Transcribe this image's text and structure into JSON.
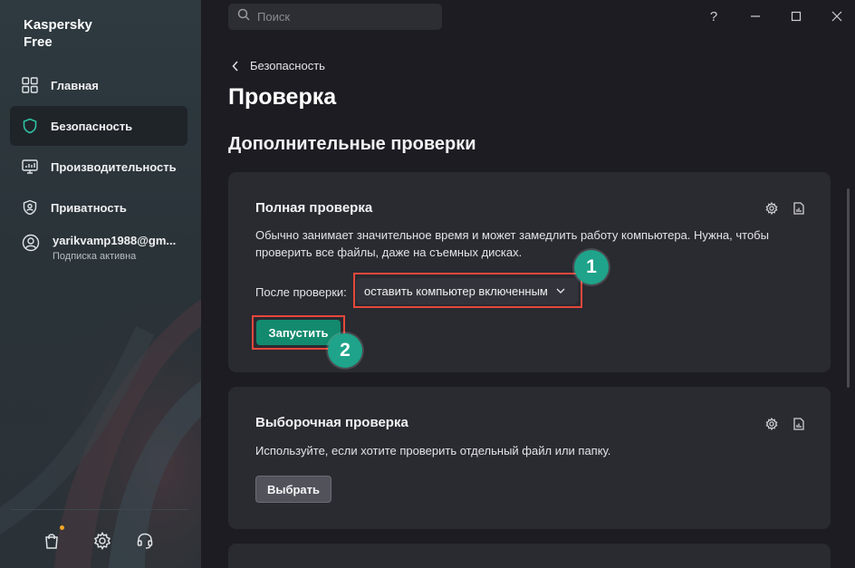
{
  "app": {
    "brand": "Kaspersky\nFree"
  },
  "sidebar": {
    "items": [
      {
        "label": "Главная",
        "icon": "grid-icon",
        "active": false
      },
      {
        "label": "Безопасность",
        "icon": "shield-icon",
        "active": true
      },
      {
        "label": "Производительность",
        "icon": "monitor-gauge-icon",
        "active": false
      },
      {
        "label": "Приватность",
        "icon": "privacy-shield-icon",
        "active": false
      }
    ],
    "profile": {
      "name": "yarikvamp1988@gm...",
      "subscription": "Подписка активна"
    },
    "bottom_icons": [
      "shopping-bag-icon",
      "gear-icon",
      "headset-icon"
    ]
  },
  "topbar": {
    "search_placeholder": "Поиск",
    "help": "?"
  },
  "main": {
    "breadcrumb": "Безопасность",
    "title": "Проверка",
    "section_title": "Дополнительные проверки",
    "full_scan": {
      "title": "Полная проверка",
      "description": "Обычно занимает значительное время и может замедлить работу компьютера. Нужна, чтобы проверить все файлы, даже на съемных дисках.",
      "after_label": "После проверки:",
      "after_value": "оставить компьютер включенным",
      "run_label": "Запустить",
      "badge_1": "1",
      "badge_2": "2"
    },
    "custom_scan": {
      "title": "Выборочная проверка",
      "description": "Используйте, если хотите проверить отдельный файл или папку.",
      "choose_label": "Выбрать"
    }
  },
  "colors": {
    "accent": "#138a6e",
    "badge": "#1fa38a",
    "highlight": "#e5483b",
    "notification": "#f5a623"
  }
}
